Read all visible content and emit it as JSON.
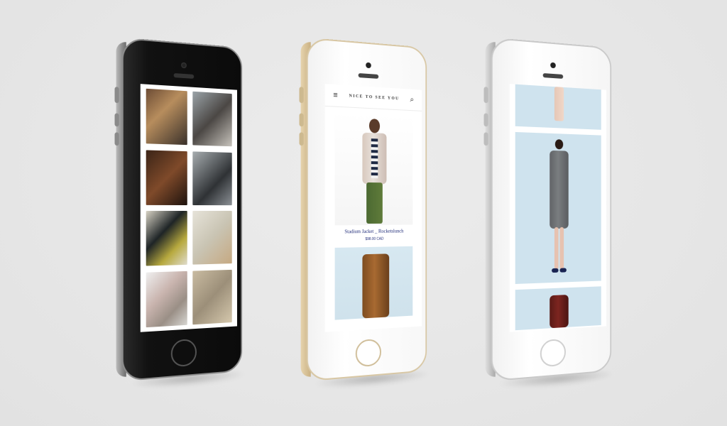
{
  "shop": {
    "brand": "NICE TO SEE YOU",
    "product1_name": "Stadium Jacket _ Rocketslunch",
    "product1_price": "$98.00 CAD"
  },
  "icons": {
    "menu": "≡",
    "search": "⌕"
  }
}
